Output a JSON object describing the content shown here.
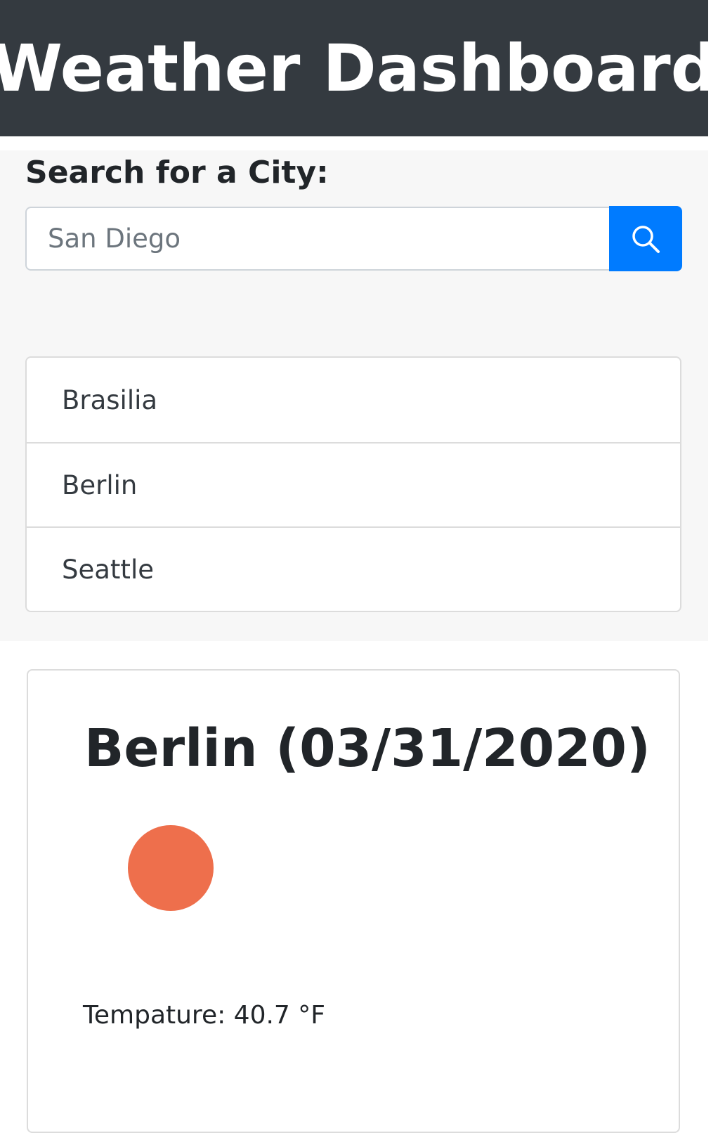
{
  "header": {
    "title": "Weather Dashboard"
  },
  "search": {
    "label": "Search for a City:",
    "placeholder": "San Diego",
    "value": "",
    "button_icon": "search-icon"
  },
  "history": {
    "items": [
      {
        "label": "Brasilia"
      },
      {
        "label": "Berlin"
      },
      {
        "label": "Seattle"
      }
    ]
  },
  "current": {
    "title": "Berlin (03/31/2020)",
    "icon": "sun-icon",
    "icon_color": "#ee6f4c",
    "temperature": "Tempature: 40.7 °F"
  },
  "colors": {
    "header_bg": "#343a40",
    "accent": "#007bff",
    "panel_bg": "#f7f7f7"
  }
}
